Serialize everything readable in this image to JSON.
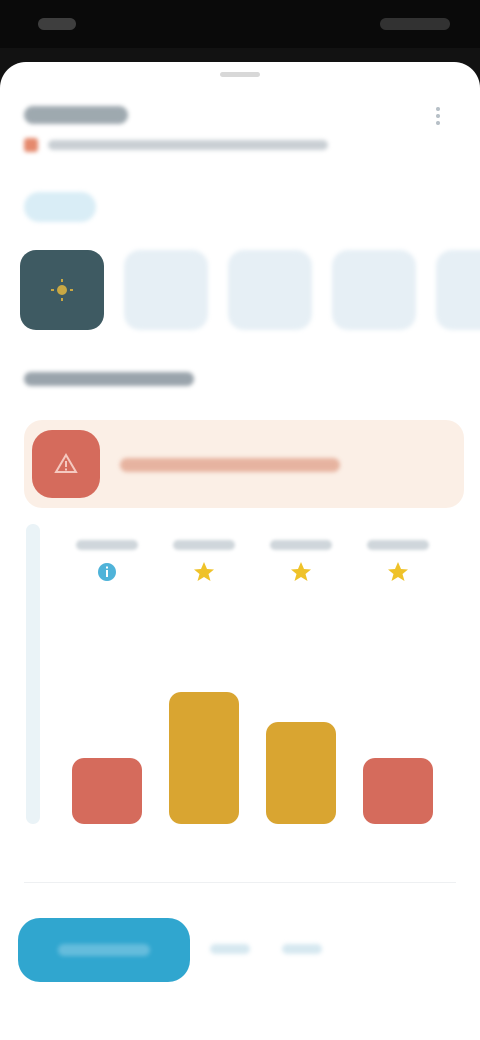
{
  "colors": {
    "accent": "#30a6cf",
    "selected_thumb": "#3e5a62",
    "alert": "#d56b5c",
    "alert_bg": "#fbefe6",
    "gold": "#d9a531",
    "star": "#efc229",
    "info": "#4fb3d9",
    "chip_bg": "#d9edf6",
    "thumb_bg": "#e6eff5"
  },
  "header": {
    "back_icon": "back-arrow-icon",
    "menu_icon": "more-vertical-icon"
  },
  "thumbnails": [
    {
      "selected": true,
      "icon": "sun-icon"
    },
    {
      "selected": false
    },
    {
      "selected": false
    },
    {
      "selected": false
    },
    {
      "selected": false
    }
  ],
  "alert": {
    "icon": "warning-icon"
  },
  "columns": [
    {
      "marker": "info-icon",
      "marker_color": "#4fb3d9",
      "bar_color": "#d56b5c",
      "level": 0.22
    },
    {
      "marker": "star-icon",
      "marker_color": "#efc229",
      "bar_color": "#d9a531",
      "level": 0.44
    },
    {
      "marker": "star-icon",
      "marker_color": "#efc229",
      "bar_color": "#d9a531",
      "level": 0.34
    },
    {
      "marker": "star-icon",
      "marker_color": "#efc229",
      "bar_color": "#d56b5c",
      "level": 0.22
    }
  ]
}
